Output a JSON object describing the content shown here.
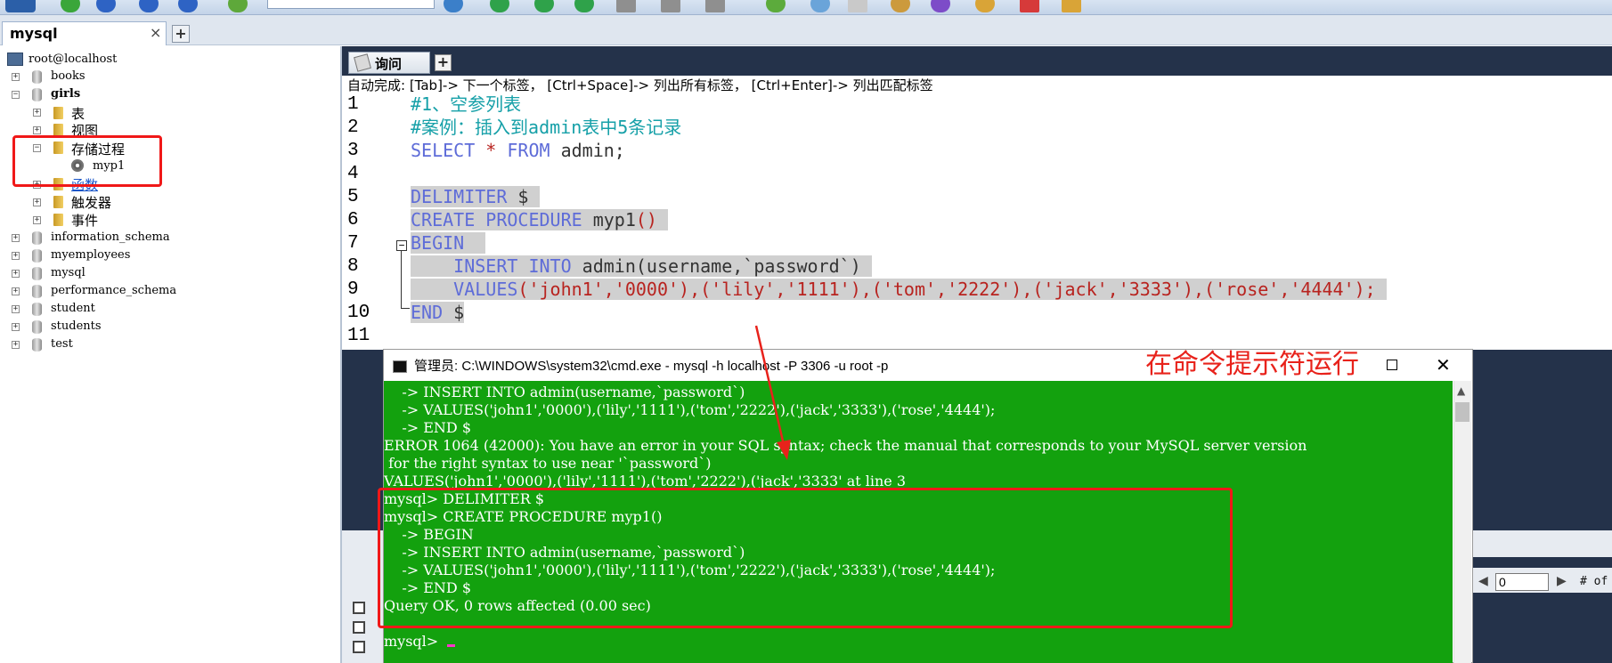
{
  "connection": {
    "tab_label": "mysql",
    "close_glyph": "×",
    "add_glyph": "+"
  },
  "tree": {
    "root": "root@localhost",
    "items": [
      {
        "label": "books"
      },
      {
        "label": "girls"
      },
      {
        "label": "表"
      },
      {
        "label": "视图"
      },
      {
        "label": "存储过程"
      },
      {
        "label": "myp1"
      },
      {
        "label": "函数"
      },
      {
        "label": "触发器"
      },
      {
        "label": "事件"
      },
      {
        "label": "information_schema"
      },
      {
        "label": "myemployees"
      },
      {
        "label": "mysql"
      },
      {
        "label": "performance_schema"
      },
      {
        "label": "student"
      },
      {
        "label": "students"
      },
      {
        "label": "test"
      }
    ]
  },
  "query_tab": {
    "label": "询问",
    "add_glyph": "+"
  },
  "editor": {
    "hint": "自动完成:  [Tab]-> 下一个标签，  [Ctrl+Space]-> 列出所有标签，  [Ctrl+Enter]-> 列出匹配标签",
    "line_numbers": [
      "1",
      "2",
      "3",
      "4",
      "5",
      "6",
      "7",
      "8",
      "9",
      "10",
      "11"
    ],
    "lines": {
      "l1": "#1、空参列表",
      "l2": "#案例：插入到admin表中5条记录",
      "l3_kw1": "SELECT",
      "l3_star": " * ",
      "l3_kw2": "FROM",
      "l3_rest": " admin;",
      "l5_kw": "DELIMITER",
      "l5_rest": " $ ",
      "l6_kw": "CREATE PROCEDURE",
      "l6_name": " myp1",
      "l6_paren": "()",
      "l7_kw": "BEGIN",
      "l8_kw": "INSERT INTO",
      "l8_rest": " admin(username,`password`) ",
      "l9_kw": "VALUES",
      "l9_vals": "('john1','0000'),('lily','1111'),('tom','2222'),('jack','3333'),('rose','4444');",
      "l10_kw": "END",
      "l10_rest": " $"
    }
  },
  "cmd": {
    "title": "管理员: C:\\WINDOWS\\system32\\cmd.exe - mysql  -h localhost -P 3306 -u root -p",
    "lines": [
      "    -> INSERT INTO admin(username,`password`)",
      "    -> VALUES('john1','0000'),('lily','1111'),('tom','2222'),('jack','3333'),('rose','4444');",
      "    -> END $",
      "ERROR 1064 (42000): You have an error in your SQL syntax; check the manual that corresponds to your MySQL server version",
      " for the right syntax to use near '`password`)",
      "VALUES('john1','0000'),('lily','1111'),('tom','2222'),('jack','3333' at line 3",
      "mysql> DELIMITER $",
      "mysql> CREATE PROCEDURE myp1()",
      "    -> BEGIN",
      "    -> INSERT INTO admin(username,`password`)",
      "    -> VALUES('john1','0000'),('lily','1111'),('tom','2222'),('jack','3333'),('rose','4444');",
      "    -> END $",
      "Query OK, 0 rows affected (0.00 sec)",
      "",
      "mysql> "
    ]
  },
  "results": {
    "offset_value": "0",
    "of_label": "# of"
  },
  "annotation": {
    "text": "在命令提示符运行"
  },
  "colors": {
    "console_bg": "#13a10e",
    "annotation": "#e8221b",
    "keyword": "#5e6cd8",
    "comment": "#16a0a8",
    "string": "#b8231f"
  }
}
